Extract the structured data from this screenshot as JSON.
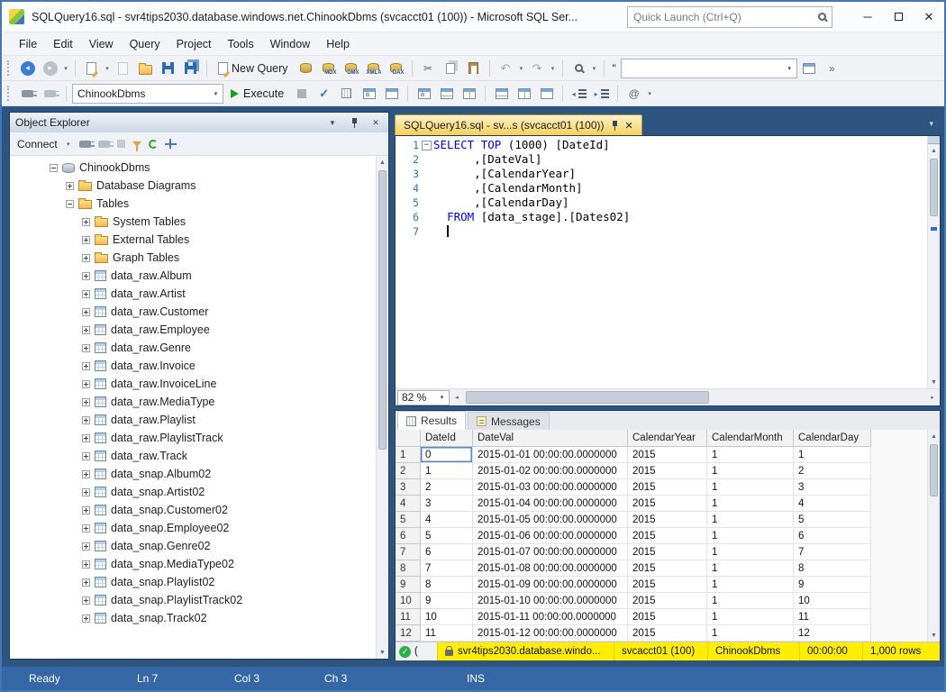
{
  "window": {
    "title": "SQLQuery16.sql - svr4tips2030.database.windows.net.ChinookDbms (svcacct01 (100)) - Microsoft SQL Ser...",
    "quick_launch": "Quick Launch (Ctrl+Q)"
  },
  "menu": {
    "items": [
      "File",
      "Edit",
      "View",
      "Query",
      "Project",
      "Tools",
      "Window",
      "Help"
    ]
  },
  "toolbar": {
    "new_query": "New Query",
    "query_type_labels": [
      "MDX",
      "DMX",
      "XMLA",
      "DAX"
    ],
    "quote_mark": "\"",
    "database_combo": "ChinookDbms",
    "execute": "Execute"
  },
  "object_explorer": {
    "title": "Object Explorer",
    "connect": "Connect",
    "tree": [
      {
        "level": 0,
        "expander": "minus",
        "icon": "db",
        "label": "ChinookDbms"
      },
      {
        "level": 1,
        "expander": "plus",
        "icon": "folder",
        "label": "Database Diagrams"
      },
      {
        "level": 1,
        "expander": "minus",
        "icon": "folder",
        "label": "Tables"
      },
      {
        "level": 2,
        "expander": "plus",
        "icon": "folder",
        "label": "System Tables"
      },
      {
        "level": 2,
        "expander": "plus",
        "icon": "folder",
        "label": "External Tables"
      },
      {
        "level": 2,
        "expander": "plus",
        "icon": "folder",
        "label": "Graph Tables"
      },
      {
        "level": 2,
        "expander": "plus",
        "icon": "table",
        "label": "data_raw.Album"
      },
      {
        "level": 2,
        "expander": "plus",
        "icon": "table",
        "label": "data_raw.Artist"
      },
      {
        "level": 2,
        "expander": "plus",
        "icon": "table",
        "label": "data_raw.Customer"
      },
      {
        "level": 2,
        "expander": "plus",
        "icon": "table",
        "label": "data_raw.Employee"
      },
      {
        "level": 2,
        "expander": "plus",
        "icon": "table",
        "label": "data_raw.Genre"
      },
      {
        "level": 2,
        "expander": "plus",
        "icon": "table",
        "label": "data_raw.Invoice"
      },
      {
        "level": 2,
        "expander": "plus",
        "icon": "table",
        "label": "data_raw.InvoiceLine"
      },
      {
        "level": 2,
        "expander": "plus",
        "icon": "table",
        "label": "data_raw.MediaType"
      },
      {
        "level": 2,
        "expander": "plus",
        "icon": "table",
        "label": "data_raw.Playlist"
      },
      {
        "level": 2,
        "expander": "plus",
        "icon": "table",
        "label": "data_raw.PlaylistTrack"
      },
      {
        "level": 2,
        "expander": "plus",
        "icon": "table",
        "label": "data_raw.Track"
      },
      {
        "level": 2,
        "expander": "plus",
        "icon": "table",
        "label": "data_snap.Album02"
      },
      {
        "level": 2,
        "expander": "plus",
        "icon": "table",
        "label": "data_snap.Artist02"
      },
      {
        "level": 2,
        "expander": "plus",
        "icon": "table",
        "label": "data_snap.Customer02"
      },
      {
        "level": 2,
        "expander": "plus",
        "icon": "table",
        "label": "data_snap.Employee02"
      },
      {
        "level": 2,
        "expander": "plus",
        "icon": "table",
        "label": "data_snap.Genre02"
      },
      {
        "level": 2,
        "expander": "plus",
        "icon": "table",
        "label": "data_snap.MediaType02"
      },
      {
        "level": 2,
        "expander": "plus",
        "icon": "table",
        "label": "data_snap.Playlist02"
      },
      {
        "level": 2,
        "expander": "plus",
        "icon": "table",
        "label": "data_snap.PlaylistTrack02"
      },
      {
        "level": 2,
        "expander": "plus",
        "icon": "table",
        "label": "data_snap.Track02"
      }
    ]
  },
  "editor": {
    "tab_title": "SQLQuery16.sql - sv...s (svcacct01 (100))",
    "zoom": "82 %",
    "code_lines": [
      {
        "n": "1",
        "kw": "SELECT",
        "mid": " ",
        "kw2": "TOP",
        "post": " (1000) [DateId]",
        "fold": "minus"
      },
      {
        "n": "2",
        "pre": "      ,[DateVal]"
      },
      {
        "n": "3",
        "pre": "      ,[CalendarYear]"
      },
      {
        "n": "4",
        "pre": "      ,[CalendarMonth]"
      },
      {
        "n": "5",
        "pre": "      ,[CalendarDay]"
      },
      {
        "n": "6",
        "pre": "  ",
        "kw": "FROM",
        "post": " [data_stage].[Dates02]"
      },
      {
        "n": "7",
        "pre": "  ",
        "caret": "true"
      }
    ]
  },
  "results": {
    "tab_results": "Results",
    "tab_messages": "Messages",
    "columns": [
      "DateId",
      "DateVal",
      "CalendarYear",
      "CalendarMonth",
      "CalendarDay"
    ],
    "rows": [
      {
        "n": "1",
        "cells": [
          "0",
          "2015-01-01 00:00:00.0000000",
          "2015",
          "1",
          "1"
        ]
      },
      {
        "n": "2",
        "cells": [
          "1",
          "2015-01-02 00:00:00.0000000",
          "2015",
          "1",
          "2"
        ]
      },
      {
        "n": "3",
        "cells": [
          "2",
          "2015-01-03 00:00:00.0000000",
          "2015",
          "1",
          "3"
        ]
      },
      {
        "n": "4",
        "cells": [
          "3",
          "2015-01-04 00:00:00.0000000",
          "2015",
          "1",
          "4"
        ]
      },
      {
        "n": "5",
        "cells": [
          "4",
          "2015-01-05 00:00:00.0000000",
          "2015",
          "1",
          "5"
        ]
      },
      {
        "n": "6",
        "cells": [
          "5",
          "2015-01-06 00:00:00.0000000",
          "2015",
          "1",
          "6"
        ]
      },
      {
        "n": "7",
        "cells": [
          "6",
          "2015-01-07 00:00:00.0000000",
          "2015",
          "1",
          "7"
        ]
      },
      {
        "n": "8",
        "cells": [
          "7",
          "2015-01-08 00:00:00.0000000",
          "2015",
          "1",
          "8"
        ]
      },
      {
        "n": "9",
        "cells": [
          "8",
          "2015-01-09 00:00:00.0000000",
          "2015",
          "1",
          "9"
        ]
      },
      {
        "n": "10",
        "cells": [
          "9",
          "2015-01-10 00:00:00.0000000",
          "2015",
          "1",
          "10"
        ]
      },
      {
        "n": "11",
        "cells": [
          "10",
          "2015-01-11 00:00:00.0000000",
          "2015",
          "1",
          "11"
        ]
      },
      {
        "n": "12",
        "cells": [
          "11",
          "2015-01-12 00:00:00.0000000",
          "2015",
          "1",
          "12"
        ]
      }
    ]
  },
  "status_strip": {
    "left": "(",
    "server": "svr4tips2030.database.windo...",
    "user": "svcacct01 (100)",
    "database": "ChinookDbms",
    "time": "00:00:00",
    "rows": "1,000 rows"
  },
  "statusbar": {
    "ready": "Ready",
    "ln": "Ln 7",
    "col": "Col 3",
    "ch": "Ch 3",
    "ins": "INS"
  }
}
